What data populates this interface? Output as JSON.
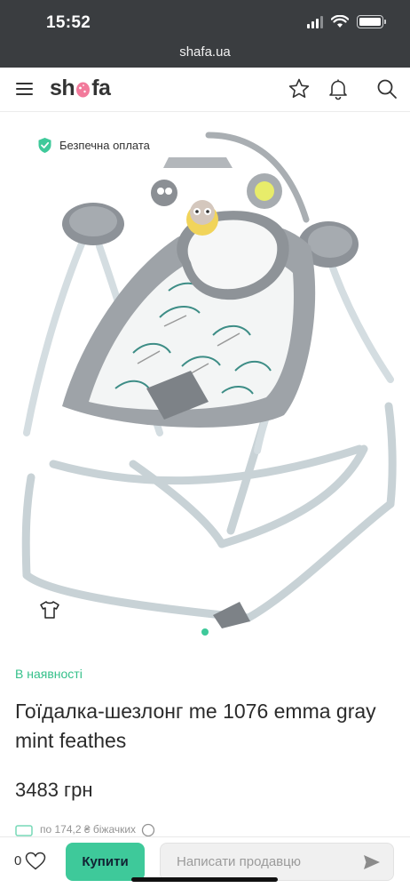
{
  "status_bar": {
    "time": "15:52",
    "signal_icon": "cellular-signal-icon",
    "wifi_icon": "wifi-icon",
    "battery_icon": "battery-icon"
  },
  "browser": {
    "url": "shafa.ua"
  },
  "header": {
    "logo_prefix": "sh",
    "logo_suffix": "fa",
    "menu_icon": "hamburger-menu-icon",
    "favorites_icon": "star-icon",
    "notifications_icon": "bell-icon",
    "search_icon": "search-icon"
  },
  "gallery": {
    "secure_payment_label": "Безпечна оплата",
    "secure_icon": "shield-check-icon",
    "size_icon": "t-shirt-icon",
    "image_count": 1,
    "active_image": 1
  },
  "product": {
    "availability": "В наявності",
    "title": "Гоїдалка-шезлонг me 1076 emma gray mint feathes",
    "price": "3483 грн",
    "installment_text": "по 174,2 ₴ біжачких"
  },
  "bottom_bar": {
    "likes_count": "0",
    "heart_icon": "heart-icon",
    "buy_label": "Купити",
    "message_placeholder": "Написати продавцю",
    "send_icon": "send-arrow-icon"
  },
  "colors": {
    "accent": "#3ec99a",
    "top_bar": "#3a3d40",
    "logo_pink": "#f27a9b"
  }
}
